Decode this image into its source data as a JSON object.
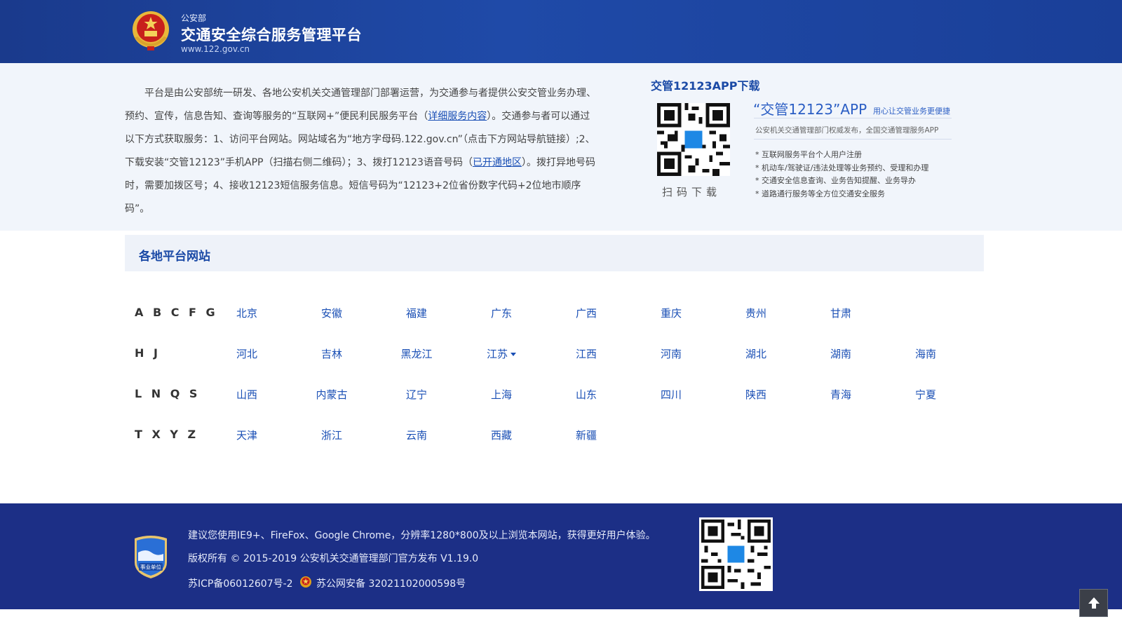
{
  "header": {
    "org": "公安部",
    "title": "交通安全综合服务管理平台",
    "url": "www.122.gov.cn"
  },
  "intro": {
    "part1": "平台是由公安部统一研发、各地公安机关交通管理部门部署运营，为交通参与者提供公安交管业务办理、预约、宣传，信息告知、查询等服务的“互联网+”便民利民服务平台（",
    "link1": "详细服务内容",
    "part2": "）。交通参与者可以通过以下方式获取服务：1、访问平台网站。网站域名为“地方字母码.122.gov.cn”（点击下方网站导航链接）;2、下载安装“交管12123”手机APP（扫描右侧二维码）；3、拨打12123语音号码（",
    "link2": "已开通地区",
    "part3": "）。拨打异地号码时，需要加拨区号；4、接收12123短信服务信息。短信号码为“12123+2位省份数字代码+2位地市顺序码”。"
  },
  "app": {
    "title": "交管12123APP下载",
    "scan_label": "扫码下载",
    "name": "“交管12123”APP",
    "slogan": "用心让交管业务更便捷",
    "desc": "公安机关交通管理部门权威发布，全国交通管理服务APP",
    "features": [
      "* 互联网服务平台个人用户注册",
      "* 机动车/驾驶证/违法处理等业务预约、受理和办理",
      "* 交通安全信息查询、业务告知提醒、业务导办",
      "* 道路通行服务等全方位交通安全服务"
    ]
  },
  "regions": {
    "title": "各地平台网站",
    "rows": [
      {
        "letters": "A B C F G",
        "provinces": [
          "北京",
          "安徽",
          "福建",
          "广东",
          "广西",
          "重庆",
          "贵州",
          "甘肃"
        ]
      },
      {
        "letters": "H J",
        "provinces": [
          "河北",
          "吉林",
          "黑龙江",
          "江苏",
          "江西",
          "河南",
          "湖北",
          "湖南",
          "海南"
        ]
      },
      {
        "letters": "L N Q S",
        "provinces": [
          "山西",
          "内蒙古",
          "辽宁",
          "上海",
          "山东",
          "四川",
          "陕西",
          "青海",
          "宁夏"
        ]
      },
      {
        "letters": "T X Y Z",
        "provinces": [
          "天津",
          "浙江",
          "云南",
          "西藏",
          "新疆"
        ]
      }
    ]
  },
  "footer": {
    "browser_tip": "建议您使用IE9+、FireFox、Google Chrome，分辨率1280*800及以上浏览本网站，获得更好用户体验。",
    "copyright": "版权所有 © 2015-2019 公安机关交通管理部门官方发布 V1.19.0",
    "icp": "苏ICP备06012607号-2",
    "police_record": "苏公网安备 32021102000598号",
    "badge_text": "事业单位"
  },
  "colors": {
    "header_bg": "#1f4aa6",
    "footer_bg": "#1c2f86",
    "link": "#1a4fb5",
    "intro_bg": "#f1f5fb"
  }
}
